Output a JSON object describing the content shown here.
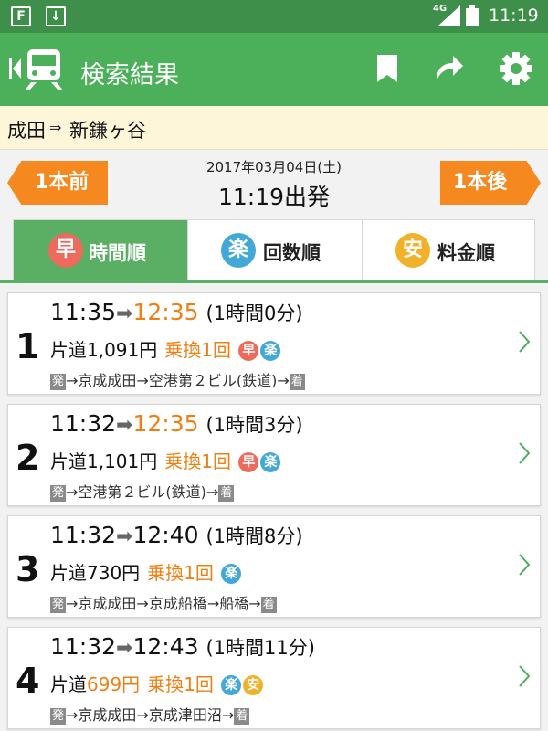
{
  "status_bar": {
    "app_icon_1": "F",
    "app_icon_2": "↓",
    "network": "4G",
    "time": "11:19"
  },
  "app_bar": {
    "title": "検索結果",
    "icons": [
      "back-to-start-icon",
      "train-icon",
      "bookmark-icon",
      "share-icon",
      "gear-icon"
    ]
  },
  "route": {
    "from": "成田",
    "arrow": "⇒",
    "to": "新鎌ヶ谷"
  },
  "date_nav": {
    "prev_label": "1本前",
    "next_label": "1本後",
    "date": "2017年03月04日(土)",
    "depart": "11:19出発"
  },
  "tabs": [
    {
      "icon": "早",
      "label": "時間順",
      "active": true
    },
    {
      "icon": "楽",
      "label": "回数順",
      "active": false
    },
    {
      "icon": "安",
      "label": "料金順",
      "active": false
    }
  ],
  "colors": {
    "status_green": "#3d8f4a",
    "app_green": "#4caf5a",
    "accent_orange": "#f5891f",
    "fast_red": "#ee6a5c",
    "easy_blue": "#42a8d8",
    "safe_yellow": "#f2b12a"
  },
  "results": [
    {
      "num": "1",
      "dep": "11:35",
      "arrow": "➡",
      "arr": "12:35",
      "duration": "(1時間0分)",
      "fare_prefix": "片道",
      "fare": "1,091円",
      "transfer": "乗換1回",
      "badges": [
        "早",
        "楽"
      ],
      "start_tag": "発",
      "stops": "→京成成田→空港第２ビル(鉄道)→",
      "end_tag": "着"
    },
    {
      "num": "2",
      "dep": "11:32",
      "arrow": "➡",
      "arr": "12:35",
      "duration": "(1時間3分)",
      "fare_prefix": "片道",
      "fare": "1,101円",
      "transfer": "乗換1回",
      "badges": [
        "早",
        "楽"
      ],
      "start_tag": "発",
      "stops": "→空港第２ビル(鉄道)→",
      "end_tag": "着"
    },
    {
      "num": "3",
      "dep": "11:32",
      "arrow": "➡",
      "arr": "12:40",
      "duration": "(1時間8分)",
      "fare_prefix": "片道",
      "fare": "730円",
      "transfer": "乗換1回",
      "badges": [
        "楽"
      ],
      "start_tag": "発",
      "stops": "→京成成田→京成船橋→船橋→",
      "end_tag": "着"
    },
    {
      "num": "4",
      "dep": "11:32",
      "arrow": "➡",
      "arr": "12:43",
      "duration": "(1時間11分)",
      "fare_prefix": "片道",
      "fare": "699円",
      "transfer": "乗換1回",
      "badges": [
        "楽",
        "安"
      ],
      "start_tag": "発",
      "stops": "→京成成田→京成津田沼→",
      "end_tag": "着"
    }
  ]
}
